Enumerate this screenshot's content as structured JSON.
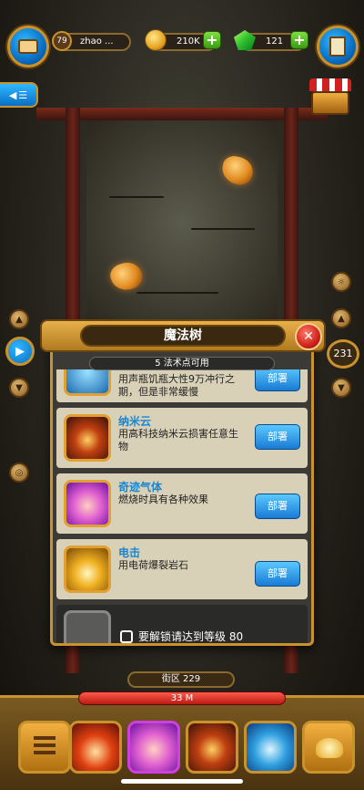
{
  "hud": {
    "level": "79",
    "player_name": "zhao ...",
    "coins": "210K",
    "gems": "121",
    "plus": "+"
  },
  "side": {
    "counter": "231"
  },
  "panel": {
    "title": "魔法树",
    "points_text": "5 法术点可用",
    "close": "✕",
    "skills": [
      {
        "name": "",
        "desc": "用声瓶饥瓶大性9万冲行之期，但是非常缓慢",
        "button": "部署",
        "color": "#3aa0e0"
      },
      {
        "name": "纳米云",
        "desc": "用高科技纳米云损害任意生物",
        "button": "部署",
        "color": "#d06a20"
      },
      {
        "name": "奇迹气体",
        "desc": "燃烧时具有各种效果",
        "button": "部署",
        "color": "#c040c0"
      },
      {
        "name": "电击",
        "desc": "用电荷爆裂岩石",
        "button": "部署",
        "color": "#e0a020"
      }
    ],
    "locked_text": "要解锁请达到等级 80"
  },
  "bottom": {
    "district": "街区 229",
    "depth": "33 M"
  }
}
